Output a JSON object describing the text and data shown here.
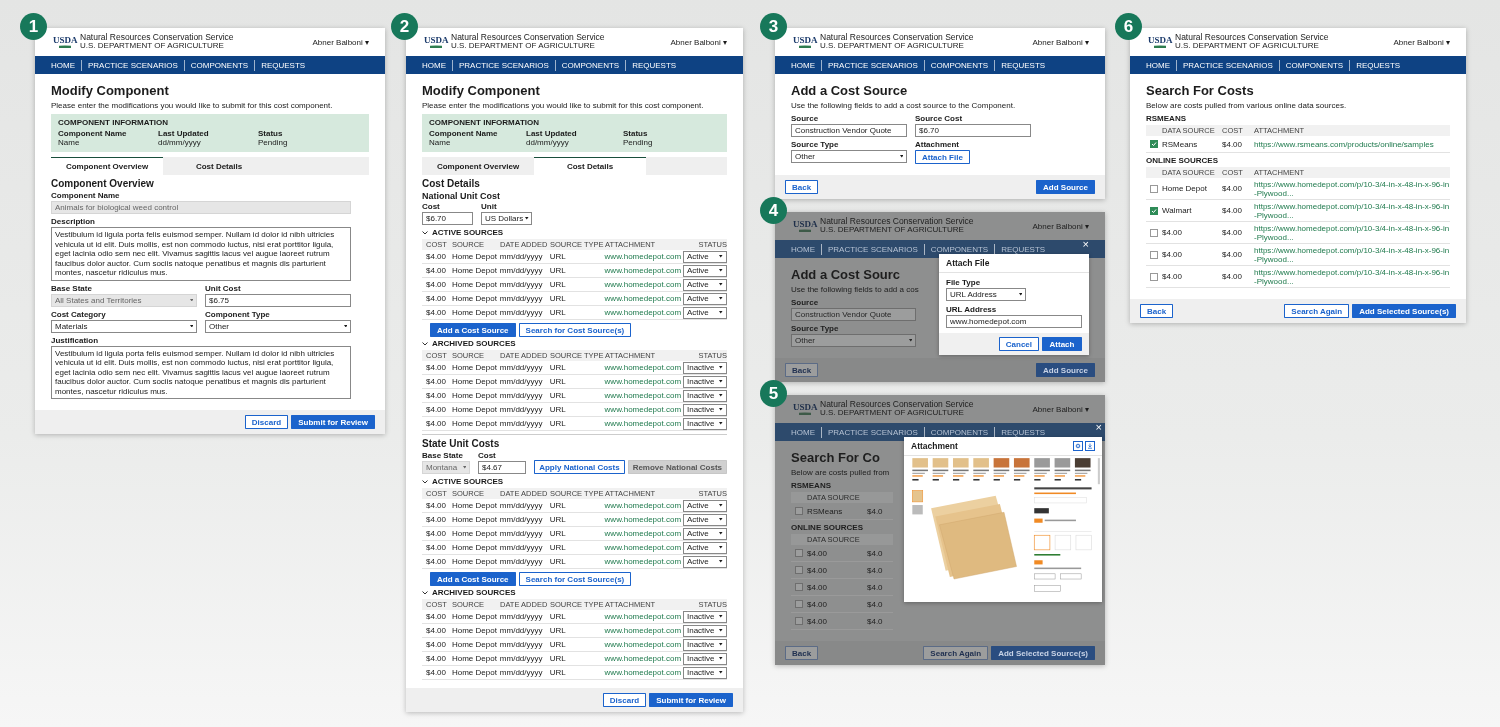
{
  "columns": [
    [
      {
        "number": "1",
        "kind": "modify_overview",
        "dimmed": false,
        "header": {
          "logo": "USDA",
          "agency": "Natural Resources Conservation Service",
          "department": "U.S. DEPARTMENT OF AGRICULTURE",
          "user": "Abner Balboni ▾"
        },
        "nav": [
          "HOME",
          "PRACTICE SCENARIOS",
          "COMPONENTS",
          "REQUESTS"
        ],
        "blocks": [
          {
            "kind": "title",
            "text": "Modify Component"
          },
          {
            "kind": "text",
            "text": "Please enter the modifications you would like to submit for this cost component."
          },
          {
            "kind": "info",
            "heading": "COMPONENT INFORMATION",
            "items": [
              {
                "label": "Component Name",
                "value": "Name"
              },
              {
                "label": "Last Updated",
                "value": "dd/mm/yyyy"
              },
              {
                "label": "Status",
                "value": "Pending"
              }
            ]
          },
          {
            "kind": "tabs",
            "items": [
              {
                "label": "Component Overview",
                "selected": true
              },
              {
                "label": "Cost Details",
                "selected": false
              }
            ]
          },
          {
            "kind": "subtitle",
            "text": "Component Overview"
          },
          {
            "kind": "fields",
            "items": [
              {
                "label": "Component Name",
                "kind": "input",
                "value": "Animals for biological weed control",
                "disabled": true
              }
            ]
          },
          {
            "kind": "fields",
            "items": [
              {
                "label": "Description",
                "kind": "textarea",
                "value": "Vestibulum id ligula porta felis euismod semper. Nullam id dolor id nibh ultricies vehicula ut id elit. Duis mollis, est non commodo luctus, nisi erat porttitor ligula, eget lacinia odio sem nec elit. Vivamus sagittis lacus vel augue laoreet rutrum faucibus dolor auctor. Cum sociis natoque penatibus et magnis dis parturient montes, nascetur ridiculus mus."
              }
            ]
          },
          {
            "kind": "fields",
            "items": [
              {
                "label": "Base State",
                "kind": "select",
                "value": "All States and Territories",
                "disabled": true
              },
              {
                "label": "Unit Cost",
                "kind": "input",
                "value": "$6.75",
                "disabled": false
              }
            ]
          },
          {
            "kind": "fields",
            "items": [
              {
                "label": "Cost Category",
                "kind": "select",
                "value": "Materials"
              },
              {
                "label": "Component Type",
                "kind": "select",
                "value": "Other"
              }
            ]
          },
          {
            "kind": "fields",
            "items": [
              {
                "label": "Justification",
                "kind": "textarea",
                "value": "Vestibulum id ligula porta felis euismod semper. Nullam id dolor id nibh ultricies vehicula ut id elit. Duis mollis, est non commodo luctus, nisi erat porttitor ligula, eget lacinia odio sem nec elit. Vivamus sagittis lacus vel augue laoreet rutrum faucibus dolor auctor. Cum sociis natoque penatibus et magnis dis parturient montes, nascetur ridiculus mus."
              }
            ]
          }
        ],
        "footer": {
          "right": [
            {
              "label": "Discard",
              "kind": "secondary"
            },
            {
              "label": "Submit for Review",
              "kind": "primary"
            }
          ]
        }
      }
    ],
    [
      {
        "number": "2",
        "kind": "modify_costs",
        "dimmed": false,
        "header": {
          "logo": "USDA",
          "agency": "Natural Resources Conservation Service",
          "department": "U.S. DEPARTMENT OF AGRICULTURE",
          "user": "Abner Balboni ▾"
        },
        "nav": [
          "HOME",
          "PRACTICE SCENARIOS",
          "COMPONENTS",
          "REQUESTS"
        ],
        "blocks": [
          {
            "kind": "title",
            "text": "Modify Component"
          },
          {
            "kind": "text",
            "text": "Please enter the modifications you would like to submit for this cost component."
          },
          {
            "kind": "info",
            "heading": "COMPONENT INFORMATION",
            "items": [
              {
                "label": "Component Name",
                "value": "Name"
              },
              {
                "label": "Last Updated",
                "value": "dd/mm/yyyy"
              },
              {
                "label": "Status",
                "value": "Pending"
              }
            ]
          },
          {
            "kind": "tabs",
            "items": [
              {
                "label": "Component Overview",
                "selected": false
              },
              {
                "label": "Cost Details",
                "selected": true
              }
            ]
          },
          {
            "kind": "subtitle",
            "text": "Cost Details"
          },
          {
            "kind": "subhead",
            "text": "National Unit Cost"
          },
          {
            "kind": "fields",
            "items": [
              {
                "label": "Cost",
                "kind": "input",
                "value": "$6.70"
              },
              {
                "label": "Unit",
                "kind": "select",
                "value": "US Dollars"
              }
            ]
          },
          {
            "kind": "sources",
            "heading": "ACTIVE SOURCES",
            "expanded": true,
            "columns": [
              "COST",
              "SOURCE",
              "DATE ADDED",
              "SOURCE TYPE",
              "ATTACHMENT",
              "STATUS"
            ],
            "rows": [
              {
                "cells": [
                  "$4.00",
                  "Home Depot",
                  "mm/dd/yyyy",
                  "URL",
                  "www.homedepot.com"
                ],
                "status": "Active"
              },
              {
                "cells": [
                  "$4.00",
                  "Home Depot",
                  "mm/dd/yyyy",
                  "URL",
                  "www.homedepot.com"
                ],
                "status": "Active"
              },
              {
                "cells": [
                  "$4.00",
                  "Home Depot",
                  "mm/dd/yyyy",
                  "URL",
                  "www.homedepot.com"
                ],
                "status": "Active"
              },
              {
                "cells": [
                  "$4.00",
                  "Home Depot",
                  "mm/dd/yyyy",
                  "URL",
                  "www.homedepot.com"
                ],
                "status": "Active"
              },
              {
                "cells": [
                  "$4.00",
                  "Home Depot",
                  "mm/dd/yyyy",
                  "URL",
                  "www.homedepot.com"
                ],
                "status": "Active"
              }
            ]
          },
          {
            "kind": "buttons",
            "items": [
              {
                "label": "Add a Cost Source",
                "kind": "primary"
              },
              {
                "label": "Search for Cost Source(s)",
                "kind": "secondary"
              }
            ]
          },
          {
            "kind": "sources",
            "heading": "ARCHIVED SOURCES",
            "expanded": true,
            "columns": [
              "COST",
              "SOURCE",
              "DATE ADDED",
              "SOURCE TYPE",
              "ATTACHMENT",
              "STATUS"
            ],
            "rows": [
              {
                "cells": [
                  "$4.00",
                  "Home Depot",
                  "mm/dd/yyyy",
                  "URL",
                  "www.homedepot.com"
                ],
                "status": "Inactive"
              },
              {
                "cells": [
                  "$4.00",
                  "Home Depot",
                  "mm/dd/yyyy",
                  "URL",
                  "www.homedepot.com"
                ],
                "status": "Inactive"
              },
              {
                "cells": [
                  "$4.00",
                  "Home Depot",
                  "mm/dd/yyyy",
                  "URL",
                  "www.homedepot.com"
                ],
                "status": "Inactive"
              },
              {
                "cells": [
                  "$4.00",
                  "Home Depot",
                  "mm/dd/yyyy",
                  "URL",
                  "www.homedepot.com"
                ],
                "status": "Inactive"
              },
              {
                "cells": [
                  "$4.00",
                  "Home Depot",
                  "mm/dd/yyyy",
                  "URL",
                  "www.homedepot.com"
                ],
                "status": "Inactive"
              }
            ]
          },
          {
            "kind": "divider"
          },
          {
            "kind": "subtitle",
            "text": "State Unit Costs"
          },
          {
            "kind": "state_costs",
            "fields": [
              {
                "label": "Base State",
                "kind": "select",
                "value": "Montana",
                "disabled": true
              },
              {
                "label": "Cost",
                "kind": "input",
                "value": "$4.67",
                "disabled": false
              }
            ],
            "actions": [
              {
                "label": "Apply National Costs",
                "kind": "secondary",
                "disabled": false
              },
              {
                "label": "Remove National Costs",
                "kind": "secondary",
                "disabled": true
              }
            ]
          },
          {
            "kind": "sources",
            "heading": "ACTIVE SOURCES",
            "expanded": true,
            "columns": [
              "COST",
              "SOURCE",
              "DATE ADDED",
              "SOURCE TYPE",
              "ATTACHMENT",
              "STATUS"
            ],
            "rows": [
              {
                "cells": [
                  "$4.00",
                  "Home Depot",
                  "mm/dd/yyyy",
                  "URL",
                  "www.homedepot.com"
                ],
                "status": "Active"
              },
              {
                "cells": [
                  "$4.00",
                  "Home Depot",
                  "mm/dd/yyyy",
                  "URL",
                  "www.homedepot.com"
                ],
                "status": "Active"
              },
              {
                "cells": [
                  "$4.00",
                  "Home Depot",
                  "mm/dd/yyyy",
                  "URL",
                  "www.homedepot.com"
                ],
                "status": "Active"
              },
              {
                "cells": [
                  "$4.00",
                  "Home Depot",
                  "mm/dd/yyyy",
                  "URL",
                  "www.homedepot.com"
                ],
                "status": "Active"
              },
              {
                "cells": [
                  "$4.00",
                  "Home Depot",
                  "mm/dd/yyyy",
                  "URL",
                  "www.homedepot.com"
                ],
                "status": "Active"
              }
            ]
          },
          {
            "kind": "buttons",
            "items": [
              {
                "label": "Add a Cost Source",
                "kind": "primary"
              },
              {
                "label": "Search for Cost Source(s)",
                "kind": "secondary"
              }
            ]
          },
          {
            "kind": "sources",
            "heading": "ARCHIVED SOURCES",
            "expanded": true,
            "columns": [
              "COST",
              "SOURCE",
              "DATE ADDED",
              "SOURCE TYPE",
              "ATTACHMENT",
              "STATUS"
            ],
            "rows": [
              {
                "cells": [
                  "$4.00",
                  "Home Depot",
                  "mm/dd/yyyy",
                  "URL",
                  "www.homedepot.com"
                ],
                "status": "Inactive"
              },
              {
                "cells": [
                  "$4.00",
                  "Home Depot",
                  "mm/dd/yyyy",
                  "URL",
                  "www.homedepot.com"
                ],
                "status": "Inactive"
              },
              {
                "cells": [
                  "$4.00",
                  "Home Depot",
                  "mm/dd/yyyy",
                  "URL",
                  "www.homedepot.com"
                ],
                "status": "Inactive"
              },
              {
                "cells": [
                  "$4.00",
                  "Home Depot",
                  "mm/dd/yyyy",
                  "URL",
                  "www.homedepot.com"
                ],
                "status": "Inactive"
              },
              {
                "cells": [
                  "$4.00",
                  "Home Depot",
                  "mm/dd/yyyy",
                  "URL",
                  "www.homedepot.com"
                ],
                "status": "Inactive"
              }
            ]
          }
        ],
        "footer": {
          "right": [
            {
              "label": "Discard",
              "kind": "secondary"
            },
            {
              "label": "Submit for Review",
              "kind": "primary"
            }
          ]
        }
      }
    ],
    [
      {
        "number": "3",
        "kind": "add_source",
        "dimmed": false,
        "header": {
          "logo": "USDA",
          "agency": "Natural Resources Conservation Service",
          "department": "U.S. DEPARTMENT OF AGRICULTURE",
          "user": "Abner Balboni ▾"
        },
        "nav": [
          "HOME",
          "PRACTICE SCENARIOS",
          "COMPONENTS",
          "REQUESTS"
        ],
        "blocks": [
          {
            "kind": "title",
            "text": "Add a Cost Source"
          },
          {
            "kind": "text",
            "text": "Use the following fields to add a cost source to the Component."
          },
          {
            "kind": "fields",
            "items": [
              {
                "label": "Source",
                "kind": "input",
                "value": "Construction Vendor Quote"
              },
              {
                "label": "Source Cost",
                "kind": "input",
                "value": "$6.70"
              }
            ]
          },
          {
            "kind": "fields",
            "items": [
              {
                "label": "Source Type",
                "kind": "select",
                "value": "Other"
              },
              {
                "label": "Attachment",
                "kind": "button",
                "value": "Attach File"
              }
            ]
          }
        ],
        "footer": {
          "left": [
            {
              "label": "Back",
              "kind": "secondary"
            }
          ],
          "right": [
            {
              "label": "Add Source",
              "kind": "primary"
            }
          ]
        }
      },
      {
        "number": "4",
        "kind": "attach_file",
        "dimmed": true,
        "header": {
          "logo": "USDA",
          "agency": "Natural Resources Conservation Service",
          "department": "U.S. DEPARTMENT OF AGRICULTURE",
          "user": "Abner Balboni ▾"
        },
        "nav": [
          "HOME",
          "PRACTICE SCENARIOS",
          "COMPONENTS",
          "REQUESTS"
        ],
        "blocks": [
          {
            "kind": "title",
            "text": "Add a Cost Sourc"
          },
          {
            "kind": "text",
            "text": "Use the following fields to add a cos"
          },
          {
            "kind": "fields",
            "items": [
              {
                "label": "Source",
                "kind": "input",
                "value": "Construction Vendor Quote"
              }
            ]
          },
          {
            "kind": "fields",
            "items": [
              {
                "label": "Source Type",
                "kind": "select",
                "value": "Other"
              }
            ]
          }
        ],
        "footer": {
          "left": [
            {
              "label": "Back",
              "kind": "secondary"
            }
          ],
          "right": [
            {
              "label": "Add Source",
              "kind": "primary"
            }
          ]
        },
        "modal": {
          "kind": "form",
          "title": "Attach File",
          "close": "×",
          "fields": [
            {
              "label": "File Type",
              "kind": "select",
              "value": "URL Address"
            },
            {
              "label": "URL Address",
              "kind": "input",
              "value": "www.homedepot.com"
            }
          ],
          "buttons": [
            {
              "label": "Cancel",
              "kind": "secondary"
            },
            {
              "label": "Attach",
              "kind": "primary"
            }
          ]
        }
      },
      {
        "number": "5",
        "kind": "attachment_view",
        "dimmed": true,
        "header": {
          "logo": "USDA",
          "agency": "Natural Resources Conservation Service",
          "department": "U.S. DEPARTMENT OF AGRICULTURE",
          "user": "Abner Balboni ▾"
        },
        "nav": [
          "HOME",
          "PRACTICE SCENARIOS",
          "COMPONENTS",
          "REQUESTS"
        ],
        "blocks": [
          {
            "kind": "title",
            "text": "Search For Co"
          },
          {
            "kind": "text",
            "text": "Below are costs pulled from"
          },
          {
            "kind": "section",
            "text": "RSMEANS"
          },
          {
            "kind": "checks",
            "columns": [
              "DATA SOURCE"
            ],
            "rows": [
              {
                "checked": false,
                "cells": [
                  "RSMeans",
                  "$4.0"
                ]
              }
            ]
          },
          {
            "kind": "section",
            "text": "ONLINE SOURCES"
          },
          {
            "kind": "checks",
            "columns": [
              "DATA SOURCE"
            ],
            "rows": [
              {
                "checked": false,
                "cells": [
                  "$4.00",
                  "$4.0"
                ]
              },
              {
                "checked": false,
                "cells": [
                  "$4.00",
                  "$4.0"
                ]
              },
              {
                "checked": false,
                "cells": [
                  "$4.00",
                  "$4.0"
                ]
              },
              {
                "checked": false,
                "cells": [
                  "$4.00",
                  "$4.0"
                ]
              },
              {
                "checked": false,
                "cells": [
                  "$4.00",
                  "$4.0"
                ]
              }
            ]
          }
        ],
        "footer": {
          "left": [
            {
              "label": "Back",
              "kind": "secondary"
            }
          ],
          "right": [
            {
              "label": "Search Again",
              "kind": "secondary"
            },
            {
              "label": "Add Selected Source(s)",
              "kind": "primary"
            }
          ]
        },
        "modal": {
          "kind": "preview",
          "title": "Attachment",
          "close": "×"
        }
      }
    ],
    [
      {
        "number": "6",
        "kind": "search_costs",
        "dimmed": false,
        "header": {
          "logo": "USDA",
          "agency": "Natural Resources Conservation Service",
          "department": "U.S. DEPARTMENT OF AGRICULTURE",
          "user": "Abner Balboni ▾"
        },
        "nav": [
          "HOME",
          "PRACTICE SCENARIOS",
          "COMPONENTS",
          "REQUESTS"
        ],
        "blocks": [
          {
            "kind": "title",
            "text": "Search For Costs"
          },
          {
            "kind": "text",
            "text": "Below are costs pulled from various online data sources."
          },
          {
            "kind": "section",
            "text": "RSMEANS"
          },
          {
            "kind": "checks",
            "columns": [
              "DATA SOURCE",
              "COST",
              "ATTACHMENT"
            ],
            "rows": [
              {
                "checked": true,
                "cells": [
                  "RSMeans",
                  "$4.00",
                  "https://www.rsmeans.com/products/online/samples"
                ]
              }
            ]
          },
          {
            "kind": "section",
            "text": "ONLINE SOURCES"
          },
          {
            "kind": "checks",
            "columns": [
              "DATA SOURCE",
              "COST",
              "ATTACHMENT"
            ],
            "rows": [
              {
                "checked": false,
                "cells": [
                  "Home Depot",
                  "$4.00",
                  "https://www.homedepot.com/p/10-3/4-in-x-48-in-x-96-in-Plywood..."
                ]
              },
              {
                "checked": true,
                "cells": [
                  "Walmart",
                  "$4.00",
                  "https://www.homedepot.com/p/10-3/4-in-x-48-in-x-96-in-Plywood..."
                ]
              },
              {
                "checked": false,
                "cells": [
                  "$4.00",
                  "$4.00",
                  "https://www.homedepot.com/p/10-3/4-in-x-48-in-x-96-in-Plywood..."
                ]
              },
              {
                "checked": false,
                "cells": [
                  "$4.00",
                  "$4.00",
                  "https://www.homedepot.com/p/10-3/4-in-x-48-in-x-96-in-Plywood..."
                ]
              },
              {
                "checked": false,
                "cells": [
                  "$4.00",
                  "$4.00",
                  "https://www.homedepot.com/p/10-3/4-in-x-48-in-x-96-in-Plywood..."
                ]
              }
            ]
          }
        ],
        "footer": {
          "left": [
            {
              "label": "Back",
              "kind": "secondary"
            }
          ],
          "right": [
            {
              "label": "Search Again",
              "kind": "secondary"
            },
            {
              "label": "Add Selected Source(s)",
              "kind": "primary"
            }
          ]
        }
      }
    ]
  ]
}
